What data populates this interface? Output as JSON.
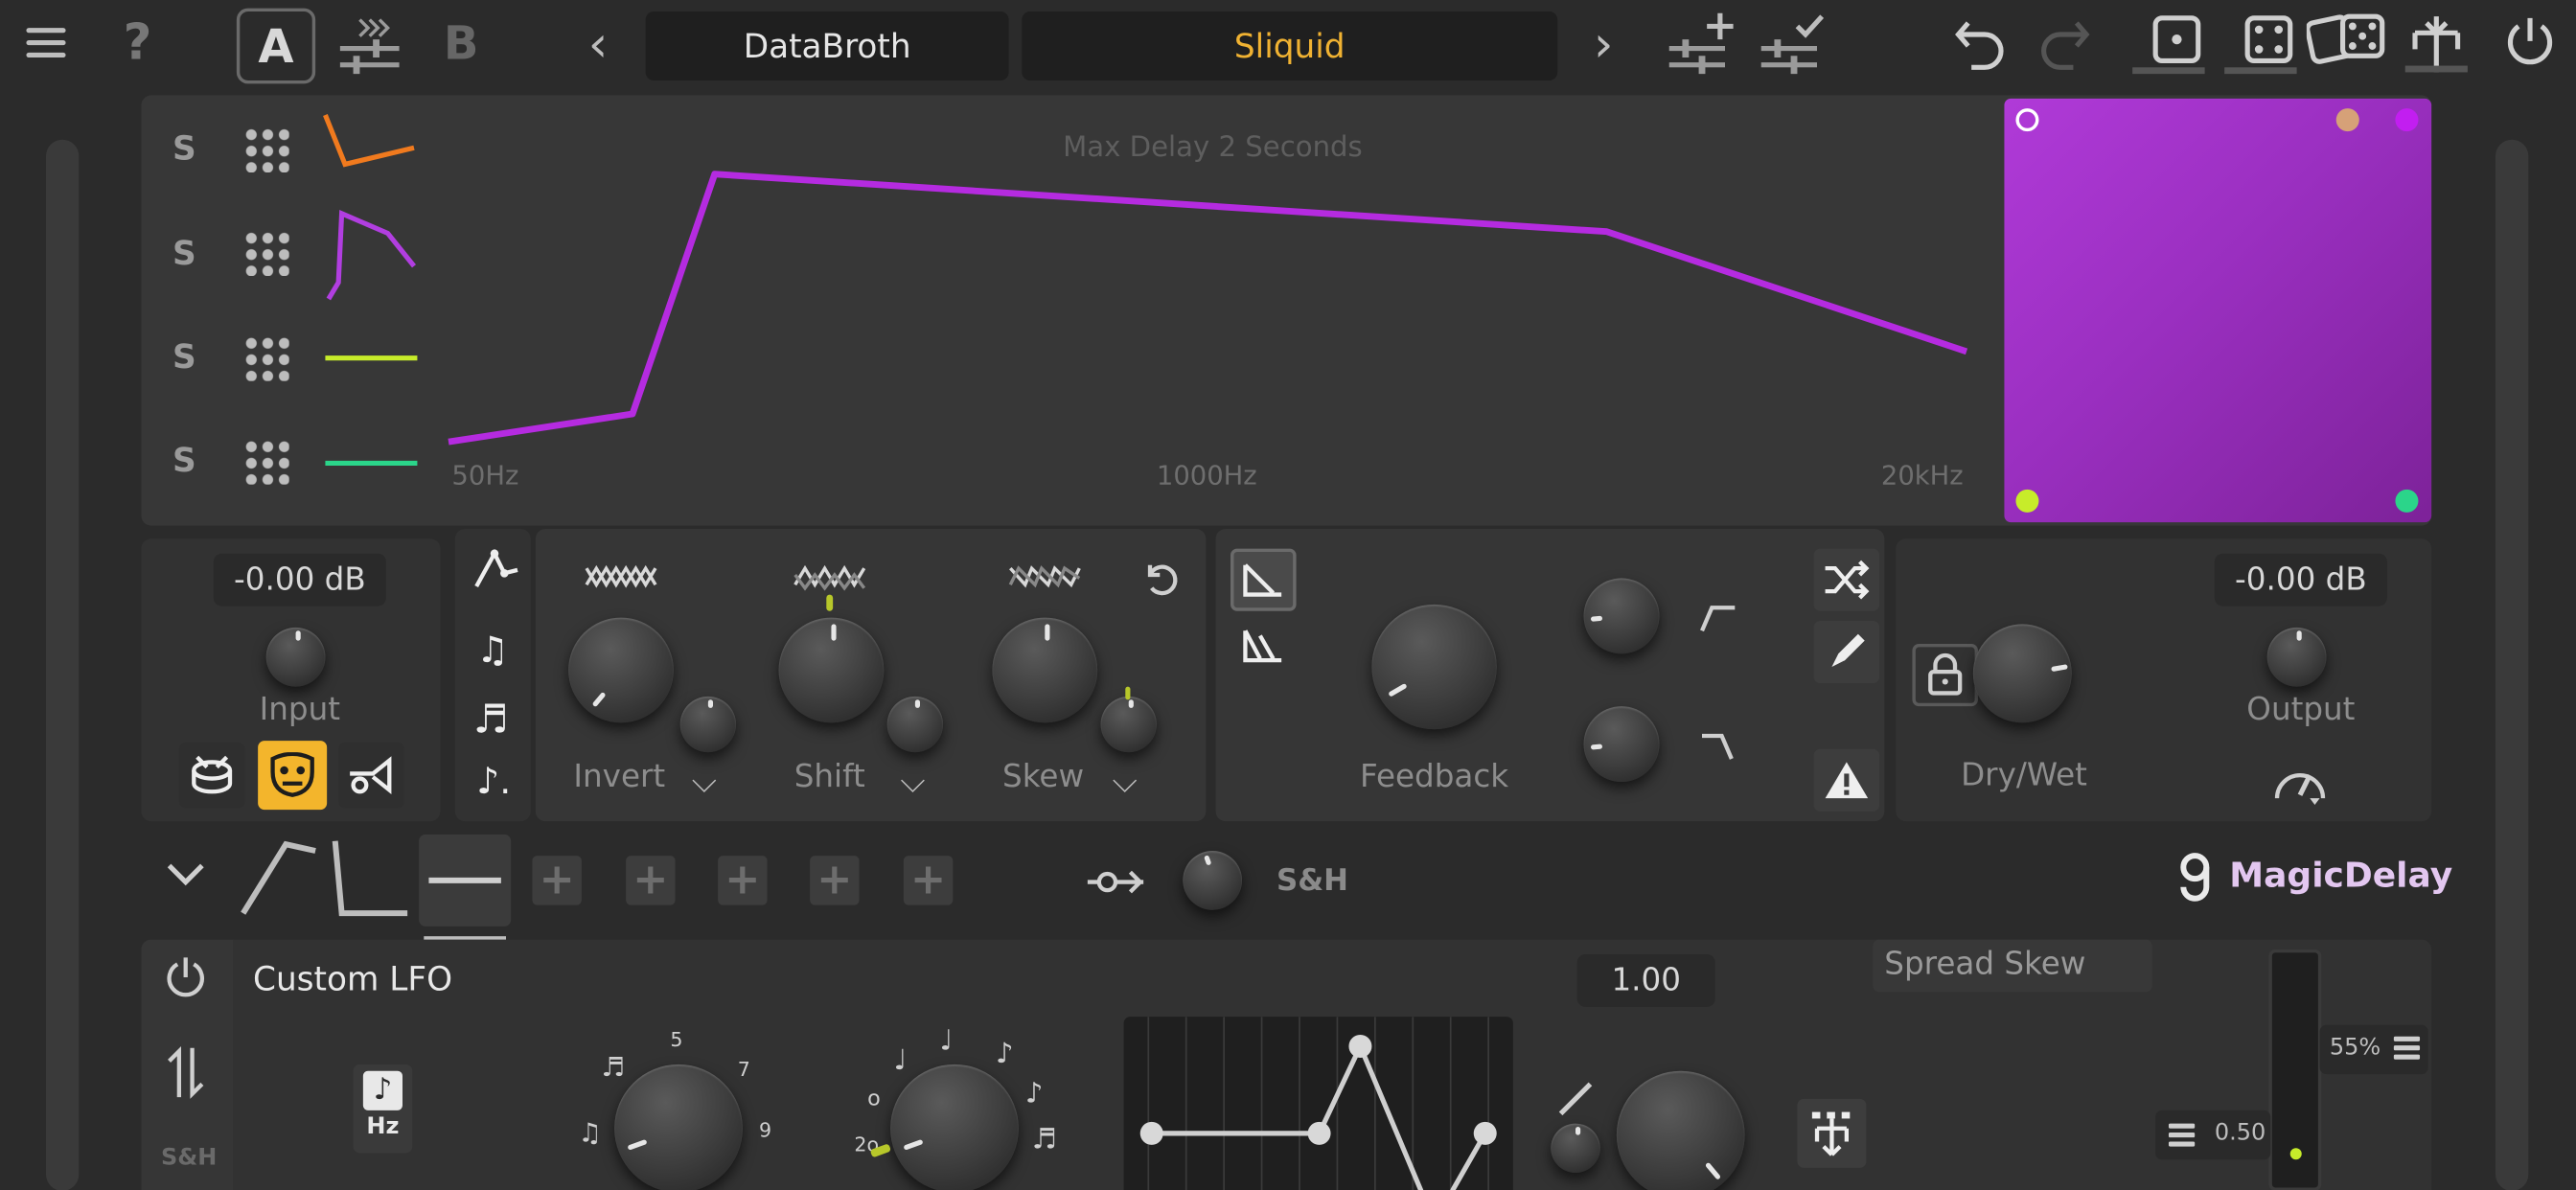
{
  "topbar": {
    "ab_a": "A",
    "ab_b": "B",
    "preset_bank": "DataBroth",
    "preset_name": "Sliquid",
    "help": "?",
    "prev": "‹",
    "next": "›"
  },
  "graph": {
    "max_delay": "Max Delay 2 Seconds",
    "freq_low": "50Hz",
    "freq_mid": "1000Hz",
    "freq_high": "20kHz",
    "rows": [
      {
        "solo": "S",
        "color": "#f07a1e"
      },
      {
        "solo": "S",
        "color": "#b13ee0"
      },
      {
        "solo": "S",
        "color": "#c7ec2a"
      },
      {
        "solo": "S",
        "color": "#2bd58a"
      }
    ],
    "curve_color": "#b52be0"
  },
  "xy_pad": {
    "dots": [
      {
        "color": "#ffffff",
        "label": "top-left"
      },
      {
        "color": "#d6a178",
        "label": "top-right-a"
      },
      {
        "color": "#c21ef0",
        "label": "top-right-b"
      },
      {
        "color": "#c7ec2a",
        "label": "bottom-left"
      },
      {
        "color": "#2bd58a",
        "label": "bottom-right"
      }
    ]
  },
  "input": {
    "value": "-0.00 dB",
    "label": "Input"
  },
  "modulators": {
    "invert": "Invert",
    "shift": "Shift",
    "skew": "Skew"
  },
  "feedback": {
    "label": "Feedback"
  },
  "output": {
    "value": "-0.00 dB",
    "label": "Output",
    "drywet": "Dry/Wet"
  },
  "lfo_bar": {
    "sh_label": "S&H",
    "brand": "MagicDelay"
  },
  "lfo": {
    "title": "Custom LFO",
    "hz_label": "Hz",
    "sh_side": "S&H",
    "rate_marks": [
      "5",
      "7",
      "9"
    ],
    "value": "1.00",
    "spread_title": "Spread Skew",
    "spread_pct": "55%",
    "spread_val": "0.50"
  }
}
